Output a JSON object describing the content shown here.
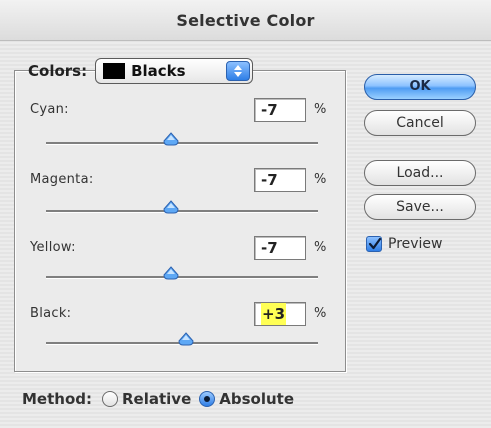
{
  "dialog": {
    "title": "Selective Color",
    "faint_left": "",
    "faint_right": ""
  },
  "colors": {
    "label": "Colors:",
    "selected": "Blacks",
    "swatch_color": "#000000"
  },
  "sliders": [
    {
      "label": "Cyan:",
      "value": "-7",
      "unit": "%",
      "position_fraction": 0.46
    },
    {
      "label": "Magenta:",
      "value": "-7",
      "unit": "%",
      "position_fraction": 0.46
    },
    {
      "label": "Yellow:",
      "value": "-7",
      "unit": "%",
      "position_fraction": 0.46
    },
    {
      "label": "Black:",
      "value": "+3",
      "unit": "%",
      "position_fraction": 0.515,
      "highlighted": true,
      "highlight_color": "#ffff55"
    }
  ],
  "buttons": {
    "ok": "OK",
    "cancel": "Cancel",
    "load": "Load...",
    "save": "Save..."
  },
  "preview": {
    "label": "Preview",
    "checked": true
  },
  "method": {
    "label": "Method:",
    "options": [
      "Relative",
      "Absolute"
    ],
    "selected": "Absolute"
  },
  "accent_color": "#2e7ee6"
}
